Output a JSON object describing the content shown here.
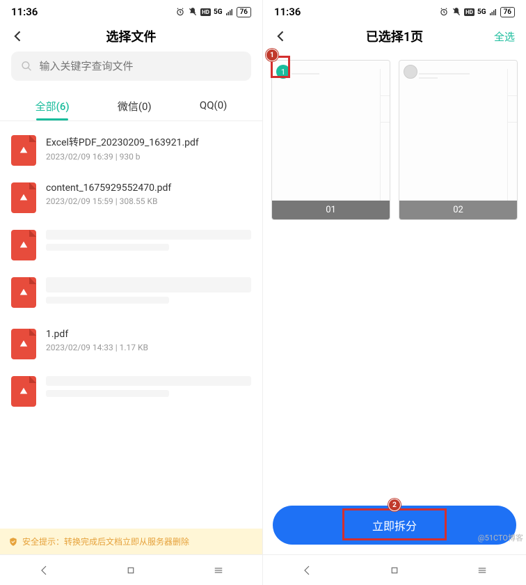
{
  "status": {
    "time": "11:36",
    "battery": "76",
    "network": "5G"
  },
  "left": {
    "title": "选择文件",
    "search_placeholder": "输入关键字查询文件",
    "tabs": [
      {
        "label": "全部(6)"
      },
      {
        "label": "微信(0)"
      },
      {
        "label": "QQ(0)"
      }
    ],
    "files": [
      {
        "name": "Excel转PDF_20230209_163921.pdf",
        "meta": "2023/02/09 16:39 |  930 b"
      },
      {
        "name": "content_1675929552470.pdf",
        "meta": "2023/02/09 15:59 |  308.55 KB"
      },
      {
        "name": "",
        "meta": "",
        "blurred": true
      },
      {
        "name": "",
        "meta": "",
        "blurred": true,
        "big": true
      },
      {
        "name": "1.pdf",
        "meta": "2023/02/09 14:33 |  1.17 KB"
      },
      {
        "name": "",
        "meta": "",
        "blurred": true
      }
    ],
    "safety": "安全提示：转换完成后文档立即从服务器删除"
  },
  "right": {
    "title": "已选择1页",
    "select_all": "全选",
    "pages": [
      {
        "label": "01",
        "selected": true,
        "order": "1"
      },
      {
        "label": "02",
        "selected": false
      }
    ],
    "action_label": "立即拆分",
    "callout1": "1",
    "callout2": "2"
  },
  "watermark": "@51CTO博客"
}
